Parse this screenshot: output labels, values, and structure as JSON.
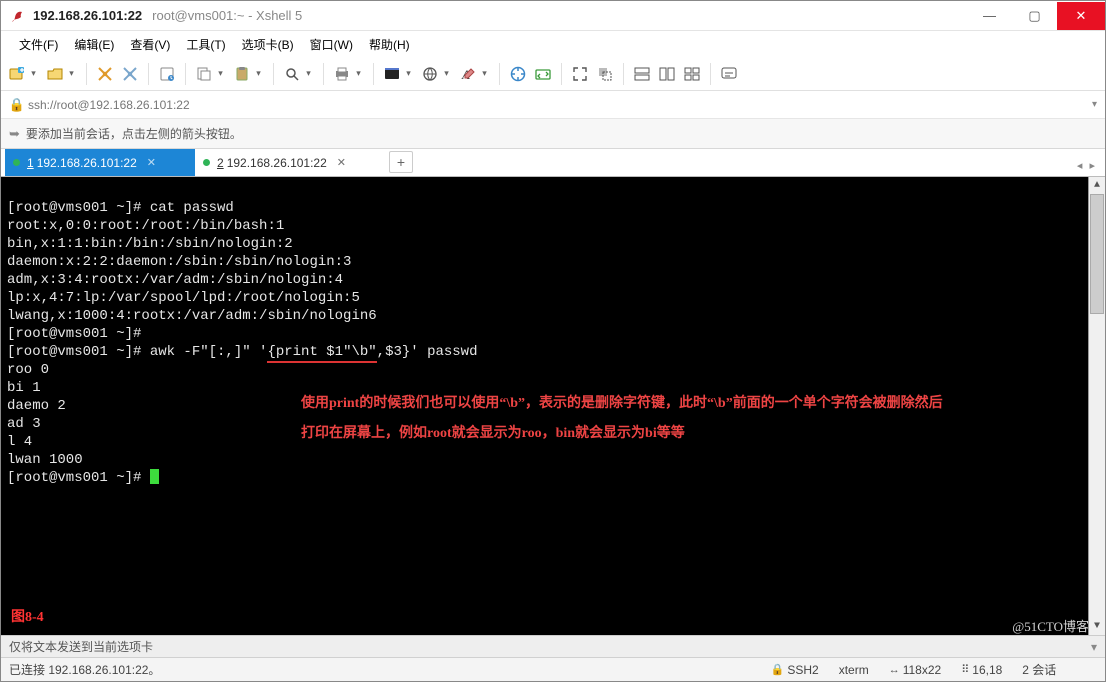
{
  "titlebar": {
    "main": "192.168.26.101:22",
    "sub": "root@vms001:~ - Xshell 5"
  },
  "menu": [
    "文件(F)",
    "编辑(E)",
    "查看(V)",
    "工具(T)",
    "选项卡(B)",
    "窗口(W)",
    "帮助(H)"
  ],
  "address": {
    "url": "ssh://root@192.168.26.101:22"
  },
  "infobar": {
    "text": "要添加当前会话，点击左侧的箭头按钮。"
  },
  "tabs": [
    {
      "seq": "1",
      "label": "192.168.26.101:22",
      "active": true
    },
    {
      "seq": "2",
      "label": "192.168.26.101:22",
      "active": false
    }
  ],
  "terminal": {
    "lines1": "[root@vms001 ~]# cat passwd\nroot:x,0:0:root:/root:/bin/bash:1\nbin,x:1:1:bin:/bin:/sbin/nologin:2\ndaemon:x:2:2:daemon:/sbin:/sbin/nologin:3\nadm,x:3:4:rootx:/var/adm:/sbin/nologin:4\nlp:x,4:7:lp:/var/spool/lpd:/root/nologin:5\nlwang,x:1000:4:rootx:/var/adm:/sbin/nologin6\n[root@vms001 ~]#",
    "cmd_prefix": "[root@vms001 ~]# awk -F\"[:,]\" '",
    "cmd_highlight": "{print $1\"\\b\"",
    "cmd_suffix": ",$3}' passwd",
    "lines2": "roo 0\nbi 1\ndaemo 2\nad 3\nl 4\nlwan 1000",
    "prompt": "[root@vms001 ~]# ",
    "fig_label": "图8-4",
    "annotation": "使用print的时候我们也可以使用“\\b”，表示的是删除字符键，此时“\\b”前面的一个单个字符会被删除然后打印在屏幕上，例如root就会显示为roo，bin就会显示为bi等等"
  },
  "sendbar": {
    "text": "仅将文本发送到当前选项卡"
  },
  "status": {
    "conn": "已连接 192.168.26.101:22。",
    "proto": "SSH2",
    "termtype": "xterm",
    "size": "118x22",
    "pos": "16,18",
    "sessions": "2 会话"
  },
  "watermark": "@51CTO博客"
}
